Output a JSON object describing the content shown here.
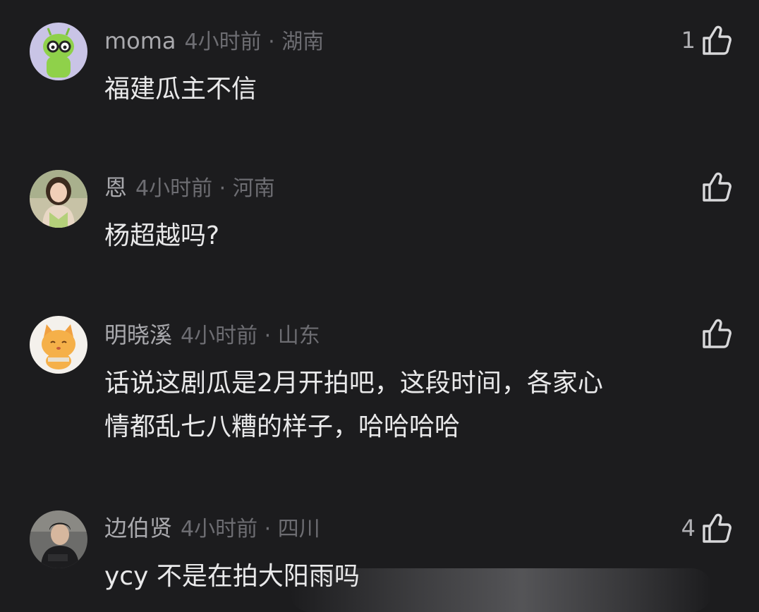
{
  "comments": [
    {
      "username": "moma",
      "time_location": "4小时前 · 湖南",
      "text_lines": [
        "福建瓜主不信"
      ],
      "likes": "1",
      "avatar": "green-robot-with-glasses"
    },
    {
      "username": "恩",
      "time_location": "4小时前 · 河南",
      "text_lines": [
        "杨超越吗?"
      ],
      "likes": "",
      "avatar": "girl-photo"
    },
    {
      "username": "明晓溪",
      "time_location": "4小时前 · 山东",
      "text_lines": [
        "话说这剧瓜是2月开拍吧，这段时间，各家心",
        "情都乱七八糟的样子，哈哈哈哈"
      ],
      "likes": "",
      "avatar": "orange-cat"
    },
    {
      "username": "边伯贤",
      "time_location": "4小时前 · 四川",
      "text_lines": [
        "ycy 不是在拍大阳雨吗"
      ],
      "likes": "4",
      "avatar": "man-photo"
    }
  ],
  "icons": {
    "like": "thumbs-up-icon"
  },
  "colors": {
    "background": "#1c1c1e",
    "username": "#a9a9ad",
    "meta": "#6d6d72",
    "text": "#e9e9ea"
  }
}
